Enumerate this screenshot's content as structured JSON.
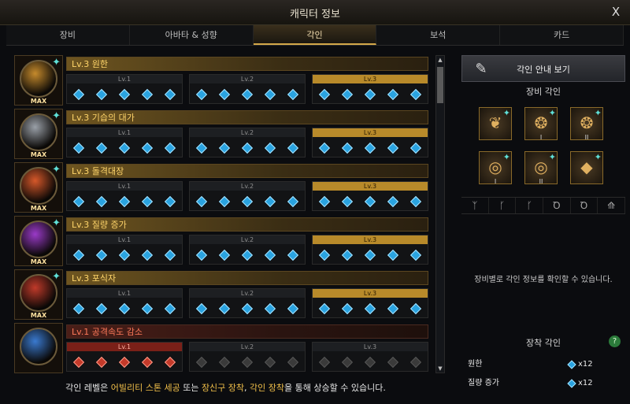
{
  "window": {
    "title": "캐릭터 정보",
    "close_label": "X"
  },
  "tabs": [
    "장비",
    "아바타 & 성향",
    "각인",
    "보석",
    "카드"
  ],
  "active_tab": 2,
  "engravings": [
    {
      "name": "Lv.3 원한",
      "max_label": "MAX",
      "levels": [
        "Lv.1",
        "Lv.2",
        "Lv.3"
      ],
      "active_level": 3,
      "color": "#c58a2c"
    },
    {
      "name": "Lv.3 기습의 대가",
      "max_label": "MAX",
      "levels": [
        "Lv.1",
        "Lv.2",
        "Lv.3"
      ],
      "active_level": 3,
      "color": "#9aa0a8"
    },
    {
      "name": "Lv.3 돌격대장",
      "max_label": "MAX",
      "levels": [
        "Lv.1",
        "Lv.2",
        "Lv.3"
      ],
      "active_level": 3,
      "color": "#d6582a"
    },
    {
      "name": "Lv.3 질량 증가",
      "max_label": "MAX",
      "levels": [
        "Lv.1",
        "Lv.2",
        "Lv.3"
      ],
      "active_level": 3,
      "color": "#9a3ac8"
    },
    {
      "name": "Lv.3 포식자",
      "max_label": "MAX",
      "levels": [
        "Lv.1",
        "Lv.2",
        "Lv.3"
      ],
      "active_level": 3,
      "color": "#c03a2a"
    },
    {
      "name": "Lv.1 공격속도 감소",
      "max_label": "",
      "levels": [
        "Lv.1",
        "Lv.2",
        "Lv.3"
      ],
      "active_level": 1,
      "color": "#3a7ad0",
      "negative": true
    }
  ],
  "footer": {
    "part1": "각인 레벨은 ",
    "hl1": "어빌리티 스톤 세공",
    "part2": " 또는 ",
    "hl2": "장신구 장착",
    "part3": ", ",
    "hl3": "각인 장착",
    "part4": "을 통해 상승할 수 있습니다."
  },
  "right": {
    "guide_button": "각인 안내 보기",
    "equip_title": "장비 각인",
    "slots": [
      {
        "icon": "necklace-icon",
        "num": ""
      },
      {
        "icon": "earring-icon",
        "num": "I"
      },
      {
        "icon": "earring-icon",
        "num": "II"
      },
      {
        "icon": "ring-icon",
        "num": "I"
      },
      {
        "icon": "ring-icon",
        "num": "II"
      },
      {
        "icon": "ability-stone-icon",
        "num": ""
      }
    ],
    "filters": [
      "necklace-filter-icon",
      "earring1-filter-icon",
      "earring2-filter-icon",
      "ring1-filter-icon",
      "ring2-filter-icon",
      "stone-filter-icon"
    ],
    "description": "장비별로 각인 정보를 확인할 수 있습니다.",
    "equipped_title": "장착 각인",
    "help_label": "?",
    "equipped": [
      {
        "name": "원한",
        "count": "x12"
      },
      {
        "name": "질량 증가",
        "count": "x12"
      }
    ]
  }
}
